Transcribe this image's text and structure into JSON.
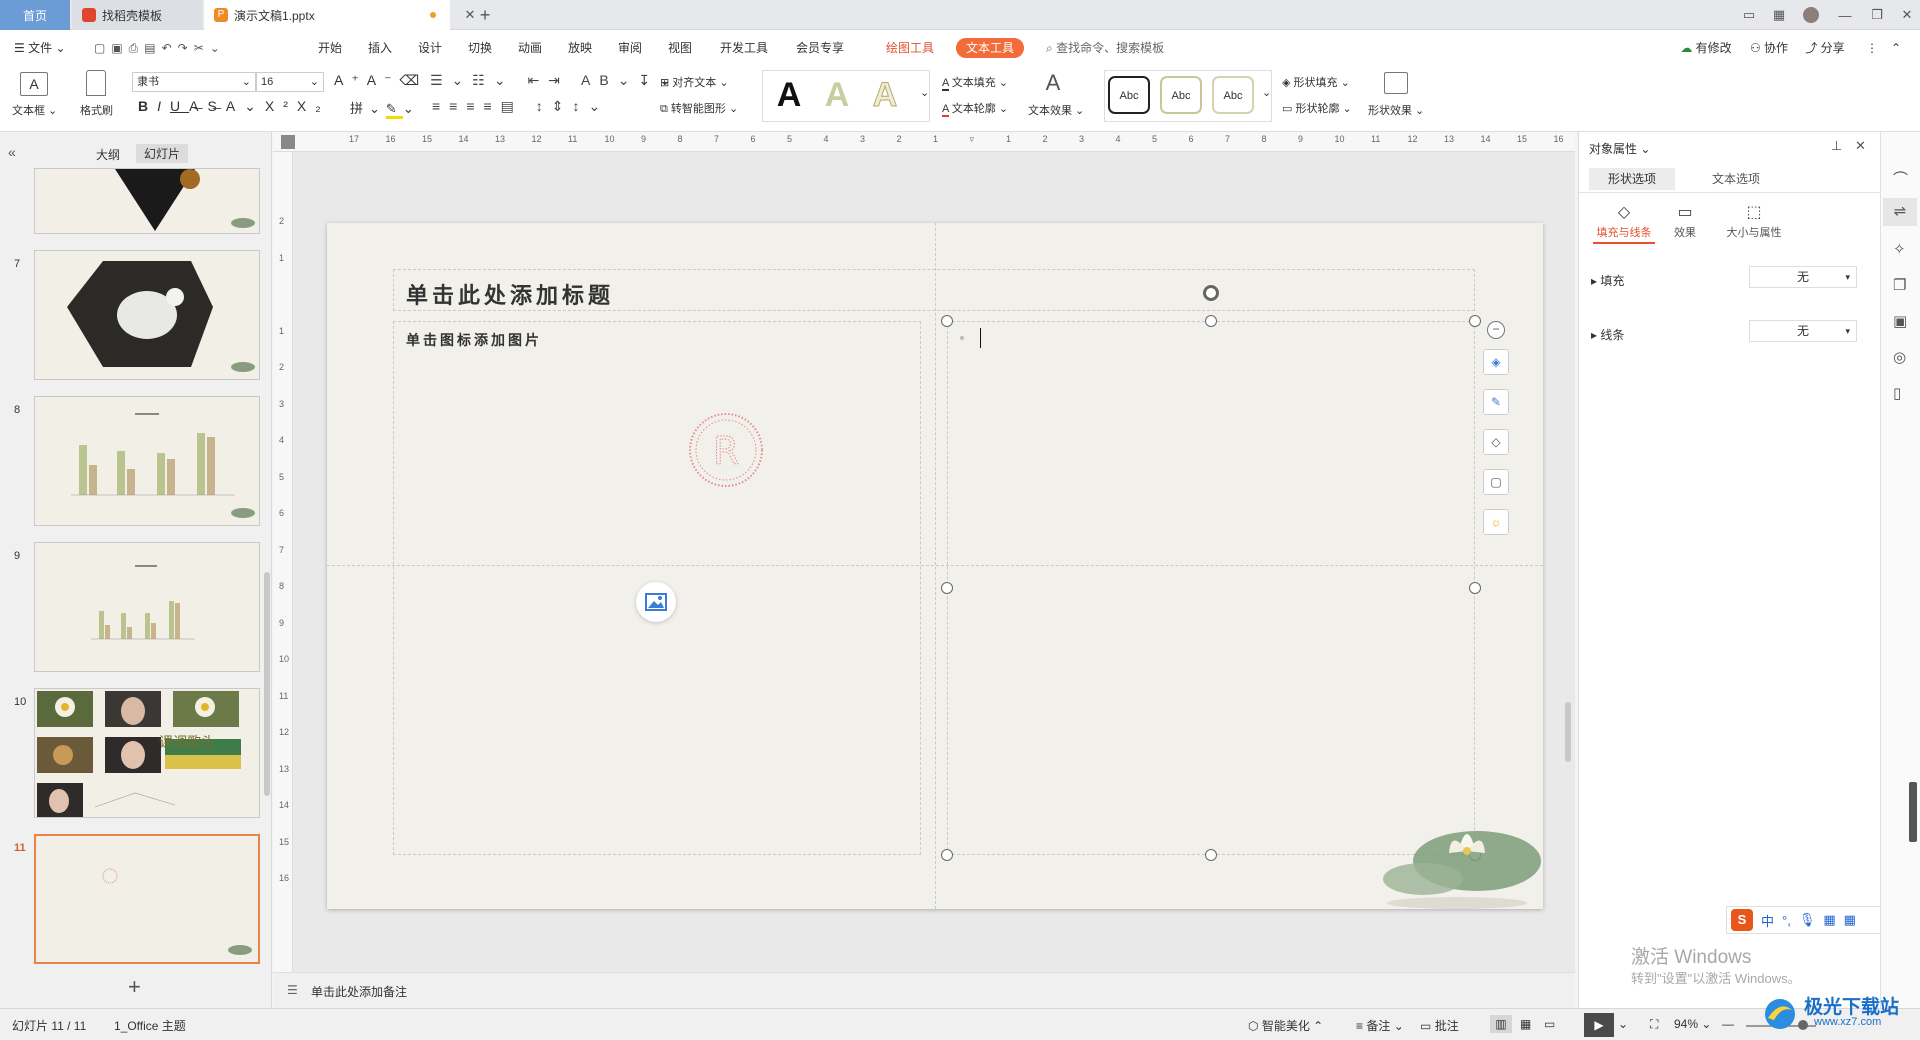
{
  "tabs": {
    "home": "首页",
    "template": "找稻壳模板",
    "doc": "演示文稿1.pptx"
  },
  "menu": {
    "file": "文件",
    "items": [
      "开始",
      "插入",
      "设计",
      "切换",
      "动画",
      "放映",
      "审阅",
      "视图",
      "开发工具",
      "会员专享"
    ],
    "drawing_tools": "绘图工具",
    "text_tools": "文本工具",
    "search": "查找命令、搜索模板",
    "changes": "有修改",
    "collaborate": "协作",
    "share": "分享"
  },
  "ribbon": {
    "textbox": "文本框",
    "format_painter": "格式刷",
    "font": "隶书",
    "font_size": "16",
    "align_text": "对齐文本",
    "smart_shape": "转智能图形",
    "text_fill": "文本填充",
    "text_outline": "文本轮廓",
    "text_effect": "文本效果",
    "abc1": "Abc",
    "abc2": "Abc",
    "abc3": "Abc",
    "shape_fill": "形状填充",
    "shape_outline": "形状轮廓",
    "shape_effect": "形状效果"
  },
  "left_panel": {
    "tab_outline": "大纲",
    "tab_slides": "幻灯片",
    "slide_numbers": [
      "7",
      "8",
      "9",
      "10",
      "11"
    ],
    "slide10_text": "课调歌头"
  },
  "slide": {
    "title_placeholder": "单击此处添加标题",
    "image_placeholder": "单击图标添加图片",
    "notes_placeholder": "单击此处添加备注"
  },
  "right_panel": {
    "header": "对象属性",
    "tab_shape": "形状选项",
    "tab_text": "文本选项",
    "sub_fill_line": "填充与线条",
    "sub_effect": "效果",
    "sub_size": "大小与属性",
    "fill_label": "填充",
    "fill_value": "无",
    "line_label": "线条",
    "line_value": "无"
  },
  "status": {
    "slide_count": "幻灯片 11 / 11",
    "theme": "1_Office 主题",
    "beautify": "智能美化",
    "notes": "备注",
    "comments": "批注",
    "zoom": "94%"
  },
  "watermark": {
    "line1": "激活 Windows",
    "line2": "转到\"设置\"以激活 Windows。",
    "site": "极光下载站",
    "url": "www.xz7.com"
  },
  "ime": {
    "lang": "中"
  },
  "ruler_top": [
    "17",
    "16",
    "15",
    "14",
    "13",
    "12",
    "11",
    "10",
    "9",
    "8",
    "7",
    "6",
    "5",
    "4",
    "3",
    "2",
    "1",
    "",
    "1",
    "2",
    "3",
    "4",
    "5",
    "6",
    "7",
    "8",
    "9",
    "10",
    "11",
    "12",
    "13",
    "14",
    "15",
    "16"
  ],
  "ruler_left": [
    "2",
    "1",
    "",
    "1",
    "2",
    "3",
    "4",
    "5",
    "6",
    "7",
    "8",
    "9",
    "10",
    "11",
    "12",
    "13",
    "14",
    "15",
    "16"
  ]
}
